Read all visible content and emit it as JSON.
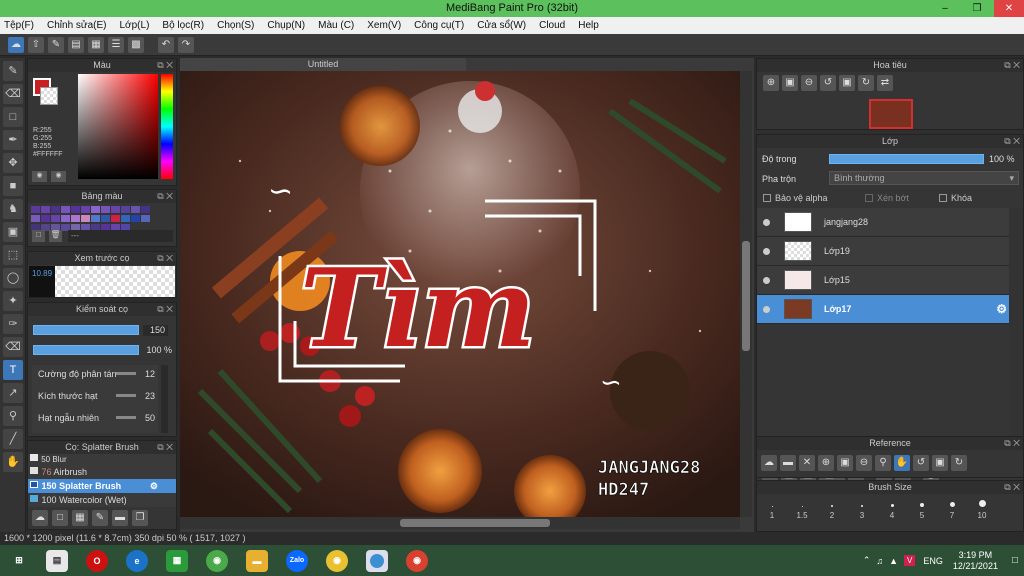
{
  "window": {
    "title": "MediBang Paint Pro (32bit)"
  },
  "menu": [
    "Tệp(F)",
    "Chỉnh sửa(E)",
    "Lớp(L)",
    "Bộ lọc(R)",
    "Chọn(S)",
    "Chụp(N)",
    "Màu (C)",
    "Xem(V)",
    "Công cụ(T)",
    "Cửa sổ(W)",
    "Cloud",
    "Help"
  ],
  "color_panel": {
    "title": "Màu",
    "r": "R:255",
    "g": "G:255",
    "b": "B:255",
    "hex": "#FFFFFF"
  },
  "palette_panel": {
    "title": "Bảng màu",
    "field": "---"
  },
  "brush_preview": {
    "title": "Xem trước cọ",
    "size": "10.89"
  },
  "brush_control": {
    "title": "Kiểm soát cọ",
    "size_value": "150",
    "opacity_value": "100 %",
    "rows": [
      {
        "label": "Cường độ phân tán",
        "value": "12"
      },
      {
        "label": "Kích thước hạt",
        "value": "23"
      },
      {
        "label": "Hạt ngẫu nhiên",
        "value": "50"
      }
    ]
  },
  "brush_list": {
    "title": "Cọ: Splatter Brush",
    "items": [
      {
        "size": "50",
        "name": "Blur",
        "color": "#e8e8e8"
      },
      {
        "size": "76",
        "name": "Airbrush",
        "color": "#e0e0e0"
      },
      {
        "size": "150",
        "name": "Splatter Brush",
        "color": "#2255aa"
      },
      {
        "size": "100",
        "name": "Watercolor (Wet)",
        "color": "#55aadd"
      }
    ]
  },
  "canvas": {
    "tab": "Untitled",
    "title_art": "Tìm",
    "credit_line1": "JANGJANG28",
    "credit_line2": "HD247"
  },
  "navigator": {
    "title": "Hoa tiêu"
  },
  "layer_panel": {
    "title": "Lớp",
    "opacity_label": "Độ trong",
    "opacity_value": "100 %",
    "blend_label": "Pha trộn",
    "blend_value": "Bình thường",
    "protect_alpha": "Bảo vệ alpha",
    "clip": "Xén bớt",
    "lock": "Khóa",
    "layers": [
      {
        "name": "jangjang28",
        "selected": false
      },
      {
        "name": "Lớp19",
        "selected": false
      },
      {
        "name": "Lớp15",
        "selected": false
      },
      {
        "name": "Lớp17",
        "selected": true
      }
    ]
  },
  "reference": {
    "title": "Reference"
  },
  "brush_size": {
    "title": "Brush Size",
    "sizes": [
      "1",
      "1.5",
      "2",
      "3",
      "4",
      "5",
      "7",
      "10"
    ]
  },
  "status": {
    "text": "1600 * 1200 pixel  (11.6 * 8.7cm)  350 dpi  50 %  ( 1517, 1027 )"
  },
  "taskbar": {
    "lang": "ENG",
    "time": "3:19 PM",
    "date": "12/21/2021"
  },
  "colors": {
    "accent": "#4a8ed6",
    "titlebar": "#5cc05c"
  }
}
